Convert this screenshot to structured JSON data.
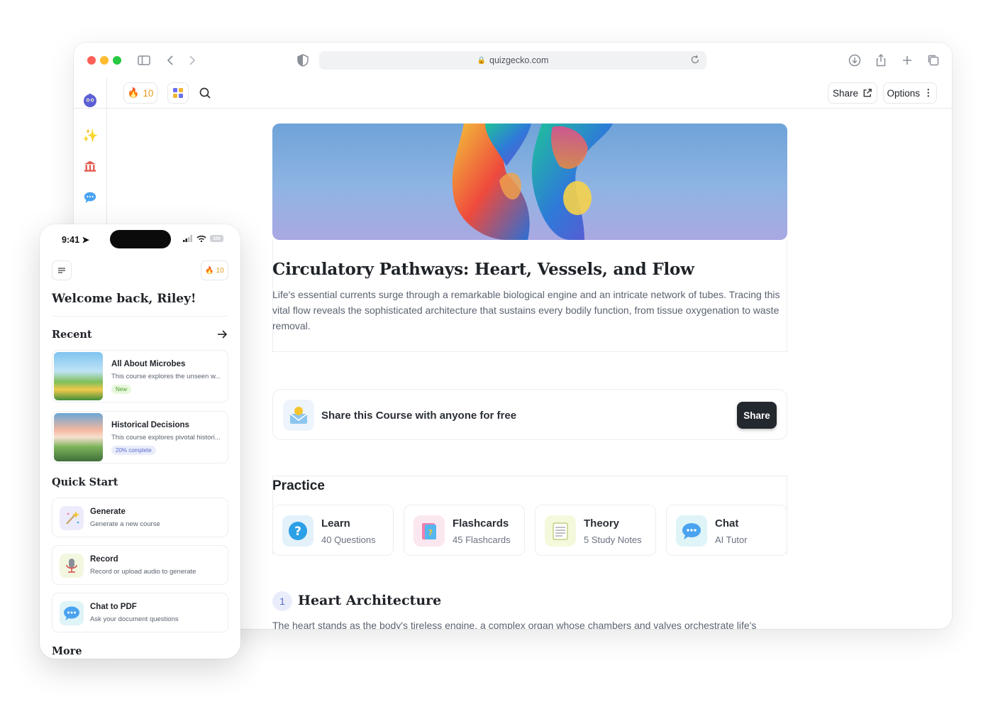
{
  "browser": {
    "url": "quizgecko.com",
    "streak_count": "10",
    "share_label": "Share",
    "options_label": "Options"
  },
  "course": {
    "title": "Circulatory Pathways: Heart, Vessels, and Flow",
    "description": "Life's essential currents surge through a remarkable biological engine and an intricate network of tubes. Tracing this vital flow reveals the sophisticated architecture that sustains every bodily function, from tissue oxygenation to waste removal."
  },
  "share_card": {
    "text": "Share this Course with anyone for free",
    "button": "Share"
  },
  "practice": {
    "title": "Practice",
    "cards": [
      {
        "title": "Learn",
        "subtitle": "40 Questions"
      },
      {
        "title": "Flashcards",
        "subtitle": "45 Flashcards"
      },
      {
        "title": "Theory",
        "subtitle": "5 Study Notes"
      },
      {
        "title": "Chat",
        "subtitle": "AI Tutor"
      }
    ]
  },
  "section": {
    "number": "1",
    "title": "Heart Architecture",
    "text": "The heart stands as the body's tireless engine, a complex organ whose chambers and valves orchestrate life's"
  },
  "phone": {
    "time": "9:41",
    "battery": "100",
    "streak_count": "10",
    "welcome": "Welcome back, Riley!",
    "recent_title": "Recent",
    "recent": [
      {
        "title": "All About Microbes",
        "description": "This course explores the unseen w...",
        "badge": "New"
      },
      {
        "title": "Historical Decisions",
        "description": "This course explores pivotal histori...",
        "badge": "20% complete"
      }
    ],
    "quick_start_title": "Quick Start",
    "quick_start": [
      {
        "title": "Generate",
        "subtitle": "Generate a new course"
      },
      {
        "title": "Record",
        "subtitle": "Record or upload audio to generate"
      },
      {
        "title": "Chat to PDF",
        "subtitle": "Ask your document questions"
      }
    ],
    "more_title": "More"
  },
  "colors": {
    "accent_dark": "#23272e",
    "streak": "#f0a020",
    "badge_new_bg": "#e7f8dc",
    "badge_progress_bg": "#e9edfb"
  }
}
